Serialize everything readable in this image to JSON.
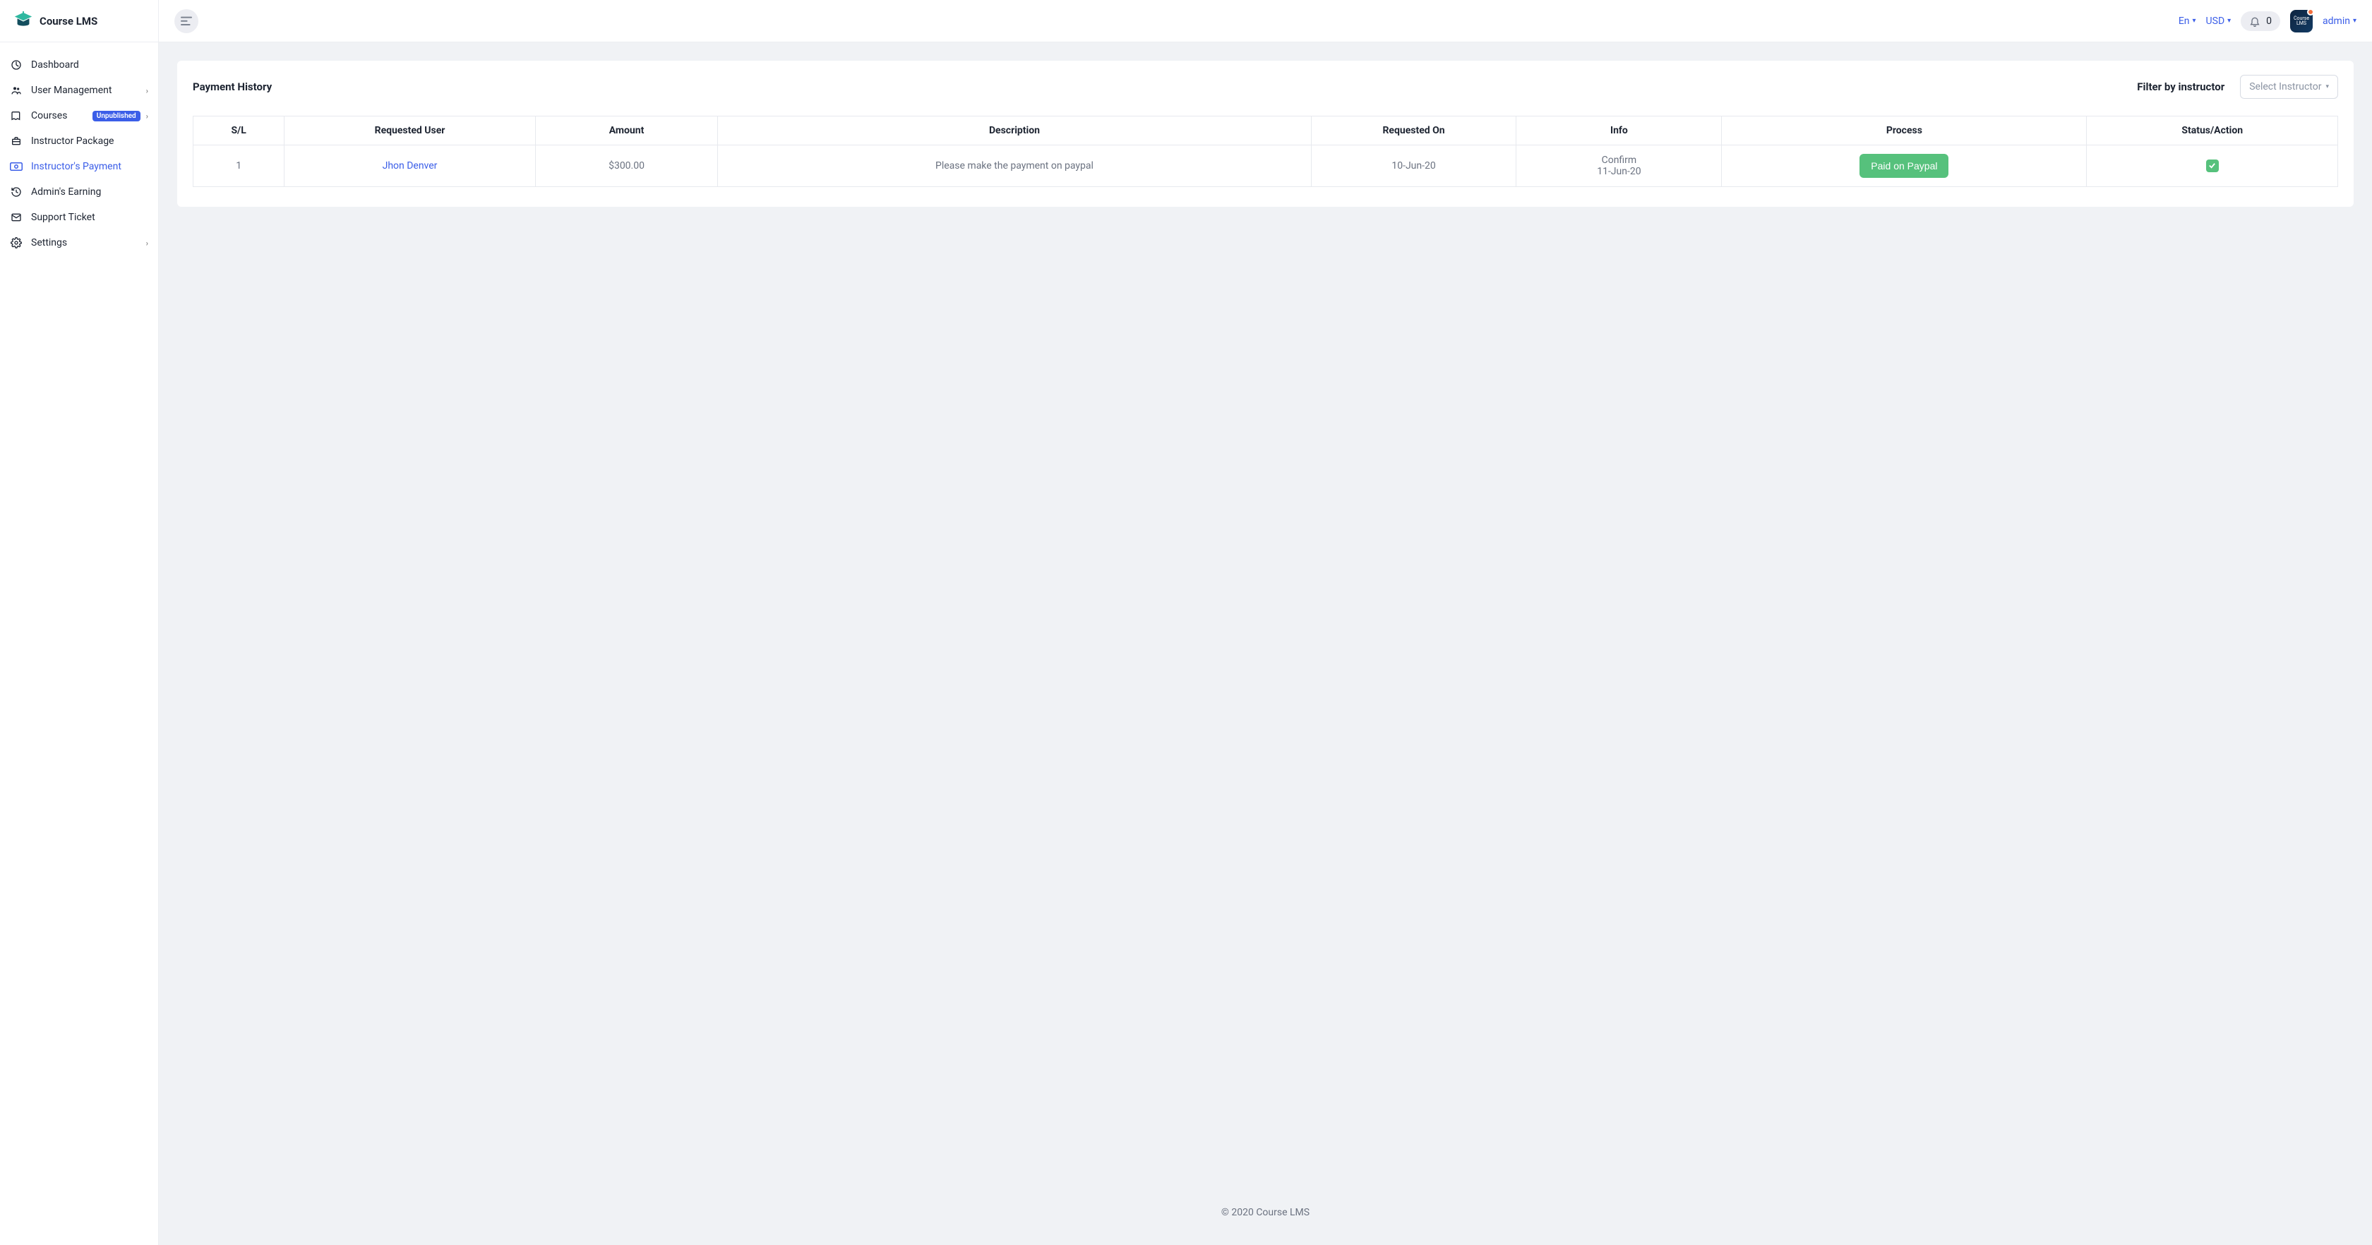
{
  "brand": {
    "name": "Course LMS"
  },
  "sidebar": {
    "items": [
      {
        "label": "Dashboard",
        "icon": "dashboard-icon",
        "expandable": false,
        "active": false
      },
      {
        "label": "User Management",
        "icon": "users-icon",
        "expandable": true,
        "active": false
      },
      {
        "label": "Courses",
        "icon": "book-icon",
        "expandable": true,
        "active": false,
        "badge": "Unpublished"
      },
      {
        "label": "Instructor Package",
        "icon": "briefcase-icon",
        "expandable": false,
        "active": false
      },
      {
        "label": "Instructor's Payment",
        "icon": "money-icon",
        "expandable": false,
        "active": true
      },
      {
        "label": "Admin's Earning",
        "icon": "history-icon",
        "expandable": false,
        "active": false
      },
      {
        "label": "Support Ticket",
        "icon": "envelope-icon",
        "expandable": false,
        "active": false
      },
      {
        "label": "Settings",
        "icon": "gear-icon",
        "expandable": true,
        "active": false
      }
    ]
  },
  "topbar": {
    "language": "En",
    "currency": "USD",
    "notifications": "0",
    "username": "admin"
  },
  "page": {
    "title": "Payment History",
    "filter_label": "Filter by instructor",
    "select_placeholder": "Select Instructor"
  },
  "table": {
    "headers": {
      "sl": "S/L",
      "user": "Requested User",
      "amount": "Amount",
      "description": "Description",
      "requested_on": "Requested On",
      "info": "Info",
      "process": "Process",
      "status": "Status/Action"
    },
    "rows": [
      {
        "sl": "1",
        "user": "Jhon Denver",
        "amount": "$300.00",
        "description": "Please make the payment on paypal",
        "requested_on": "10-Jun-20",
        "info_line1": "Confirm",
        "info_line2": "11-Jun-20",
        "process_label": "Paid on Paypal",
        "status_checked": true
      }
    ]
  },
  "footer": {
    "text": "© 2020 Course LMS"
  }
}
